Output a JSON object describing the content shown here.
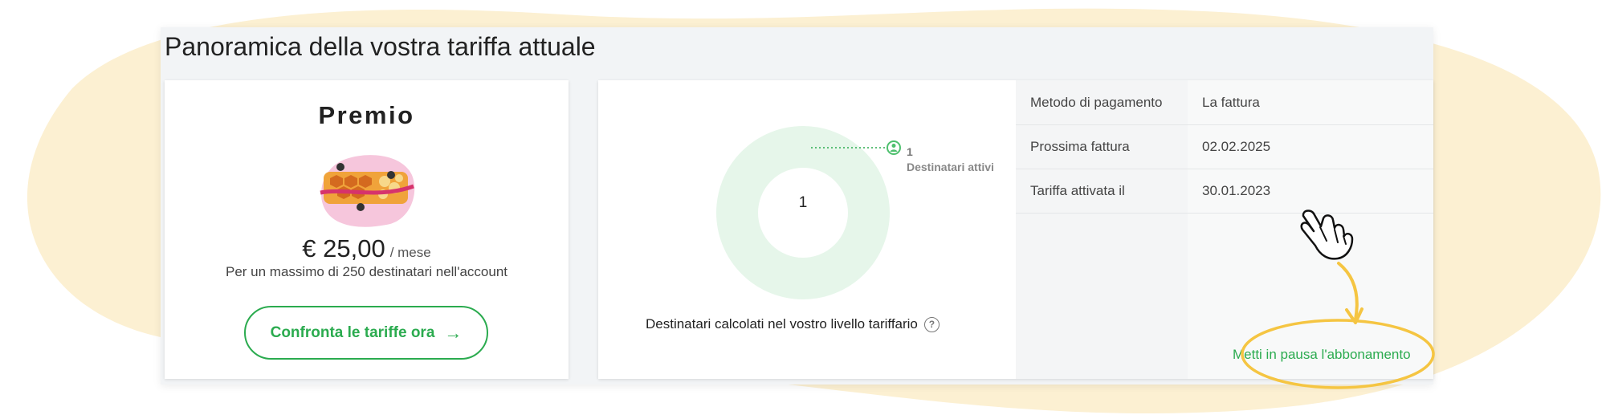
{
  "page": {
    "title": "Panoramica della vostra tariffa attuale"
  },
  "plan": {
    "name": "Premio",
    "price": "€ 25,00",
    "period": "/ mese",
    "limit": "Per un massimo di 250 destinatari nell'account",
    "compare_button": "Confronta le tariffe ora",
    "compare_icon": "arrow-right-icon"
  },
  "recipients": {
    "center_value": "1",
    "legend_count": "1",
    "legend_label": "Destinatari attivi",
    "caption": "Destinatari calcolati nel vostro livello tariffario",
    "help_icon": "?"
  },
  "details": {
    "rows": [
      {
        "label": "Metodo di pagamento",
        "value": "La fattura"
      },
      {
        "label": "Prossima fattura",
        "value": "02.02.2025"
      },
      {
        "label": "Tariffa attivata il",
        "value": "30.01.2023"
      }
    ],
    "pause_link": "Metti in pausa l'abbonamento"
  },
  "colors": {
    "accent": "#2bab4f",
    "highlight": "#f5c542",
    "background_blob": "#fcf0d2",
    "donut_fill": "#e6f6ea"
  }
}
